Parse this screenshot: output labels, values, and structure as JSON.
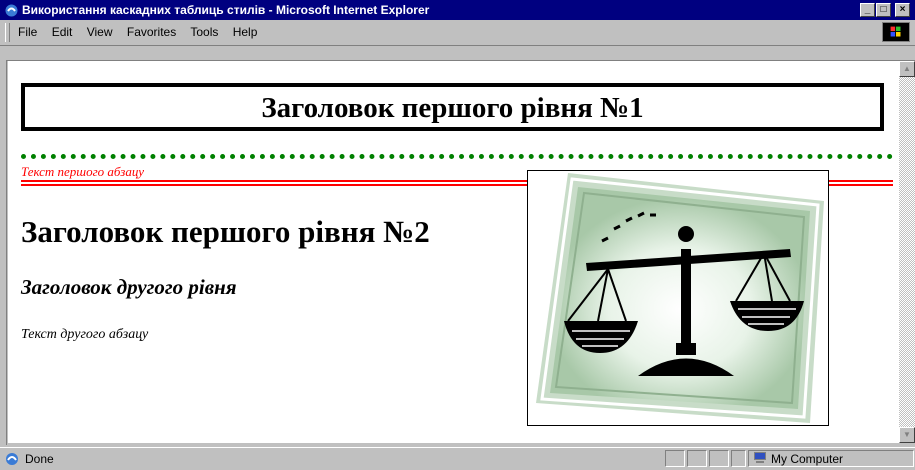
{
  "window": {
    "title": "Використання каскадних таблиць стилів - Microsoft Internet Explorer",
    "minimize": "_",
    "maximize": "□",
    "close": "×"
  },
  "menu": [
    "File",
    "Edit",
    "View",
    "Favorites",
    "Tools",
    "Help"
  ],
  "page": {
    "heading1_boxed": "Заголовок першого рівня №1",
    "first_paragraph": "Текст першого абзацу",
    "heading1_second": "Заголовок першого рівня №2",
    "heading2": "Заголовок другого рівня",
    "second_paragraph": "Текст другого абзацу"
  },
  "status": {
    "text": "Done",
    "zone": "My Computer"
  },
  "icons": [
    "ie-icon",
    "windows-logo-icon",
    "scales-clipart",
    "computer-icon"
  ],
  "colors": {
    "titlebar": "#000080",
    "dotted_line": "#008000",
    "red_text": "#ff0000"
  }
}
